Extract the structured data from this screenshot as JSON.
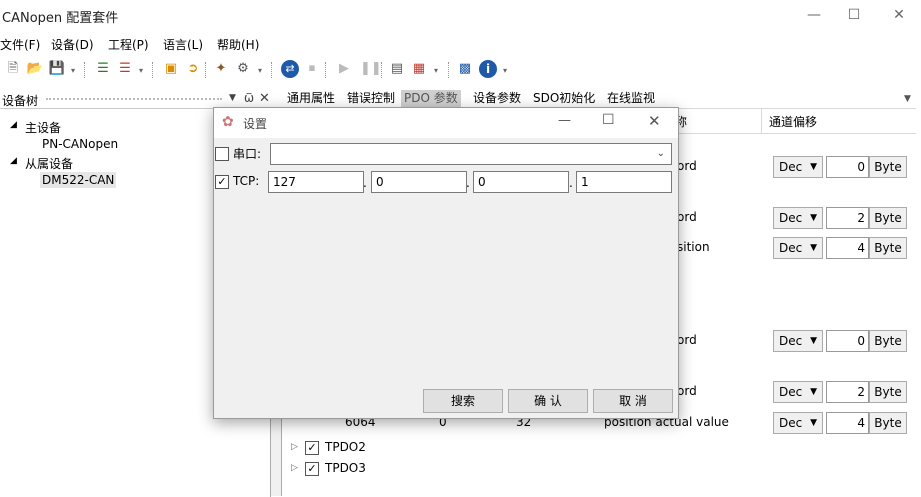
{
  "window": {
    "title": "CANopen 配置套件"
  },
  "menu": [
    "文件(F)",
    "设备(D)",
    "工程(P)",
    "语言(L)",
    "帮助(H)"
  ],
  "tree_panel": {
    "title": "设备树",
    "master_label": "主设备",
    "master_child": "PN-CANopen",
    "slave_label": "从属设备",
    "slave_child": "DM522-CAN"
  },
  "tabs": [
    "通用属性",
    "错误控制",
    "PDO 参数",
    "设备参数",
    "SDO初始化",
    "在线监视"
  ],
  "columns": {
    "name_partial": "称",
    "offset": "通道偏移"
  },
  "rows": [
    {
      "name": "ord",
      "fmt": "Dec",
      "offset": "0",
      "unit": "Byte"
    },
    {
      "name": "ord",
      "fmt": "Dec",
      "offset": "2",
      "unit": "Byte"
    },
    {
      "name": "sition",
      "fmt": "Dec",
      "offset": "4",
      "unit": "Byte"
    },
    {
      "name": "ord",
      "fmt": "Dec",
      "offset": "0",
      "unit": "Byte"
    },
    {
      "name": "ord",
      "fmt": "Dec",
      "offset": "2",
      "unit": "Byte"
    },
    {
      "index": "6064",
      "sub": "0",
      "len": "32",
      "name": "position actual value",
      "fmt": "Dec",
      "offset": "4",
      "unit": "Byte"
    }
  ],
  "pdo_nodes": [
    "TPDO2",
    "TPDO3"
  ],
  "dialog": {
    "title": "设置",
    "serial_label": "串口:",
    "serial_checked": false,
    "serial_value": "",
    "tcp_label": "TCP:",
    "tcp_checked": true,
    "ip": [
      "127",
      "0",
      "0",
      "1"
    ],
    "search_btn": "搜索",
    "ok_btn": "确 认",
    "cancel_btn": "取 消"
  }
}
